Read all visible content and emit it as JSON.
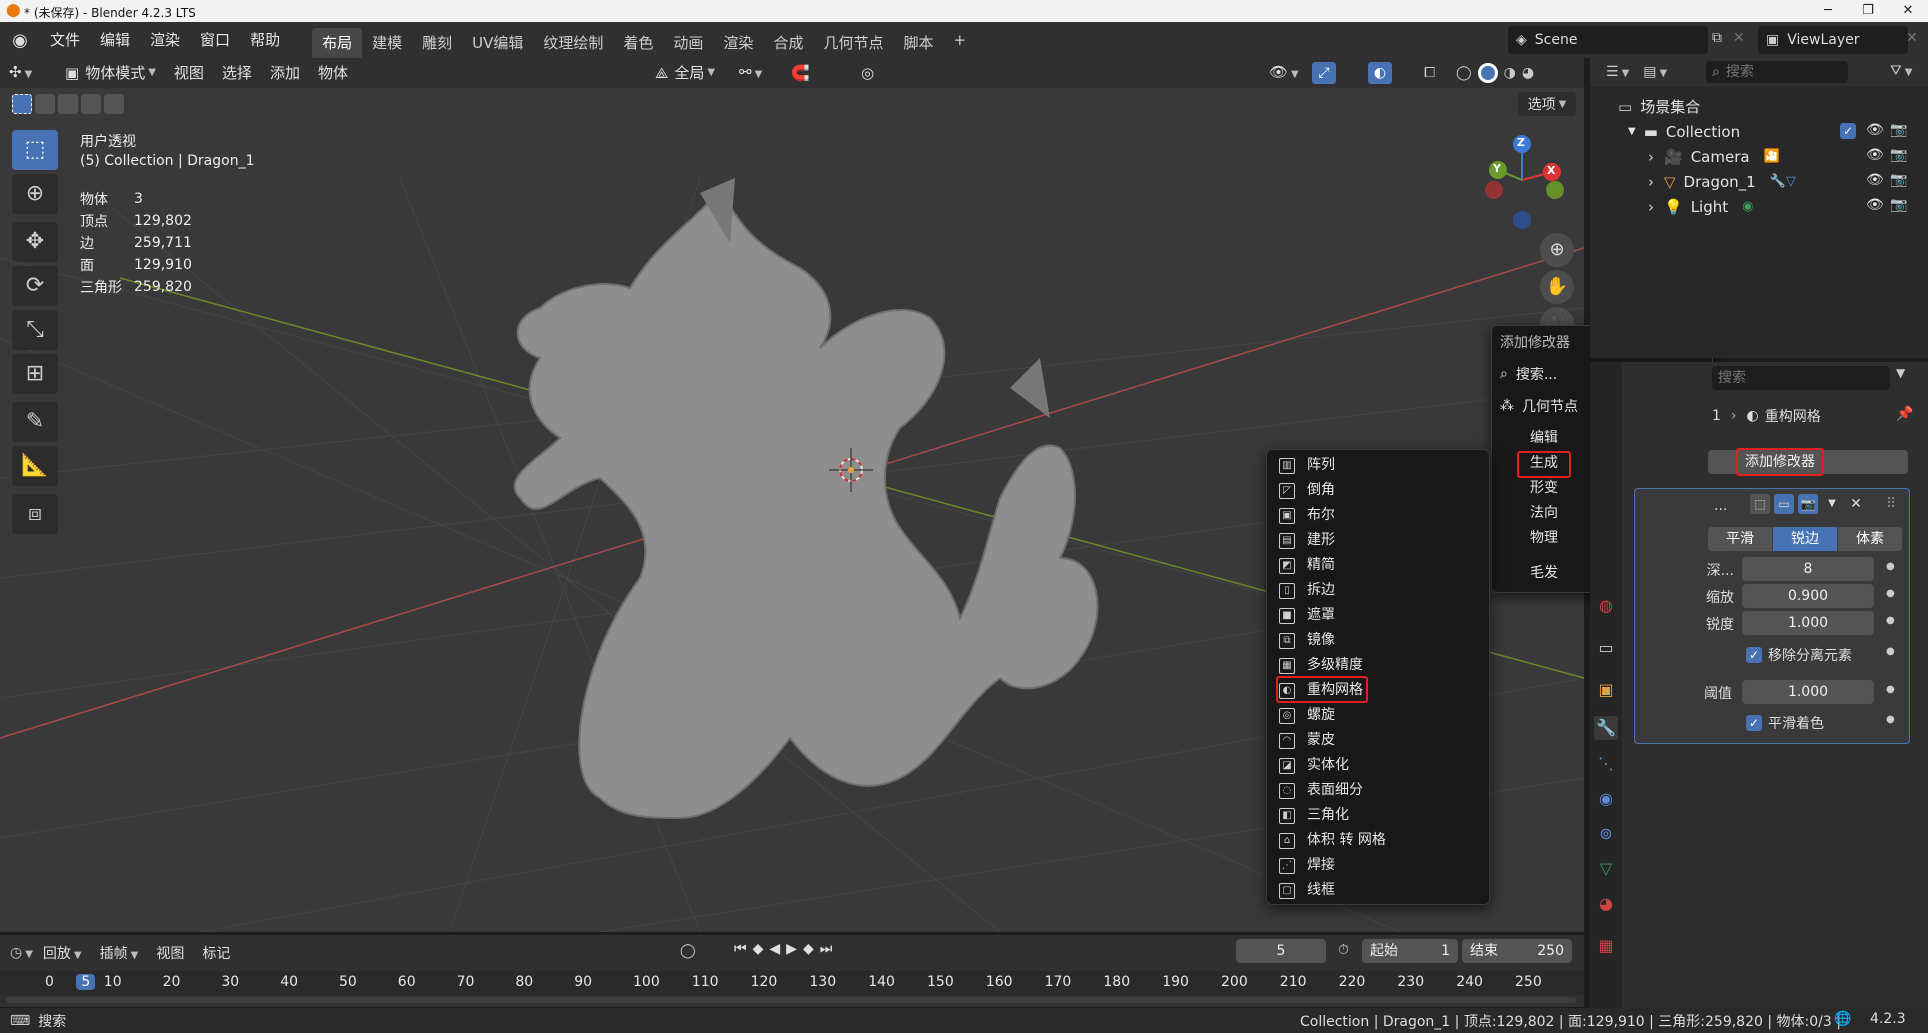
{
  "window": {
    "title": "* (未保存) - Blender 4.2.3 LTS",
    "minimize": "─",
    "maximize": "❐",
    "close": "✕"
  },
  "topbar": {
    "menus": [
      "文件",
      "编辑",
      "渲染",
      "窗口",
      "帮助"
    ],
    "tabs": [
      "布局",
      "建模",
      "雕刻",
      "UV编辑",
      "纹理绘制",
      "着色",
      "动画",
      "渲染",
      "合成",
      "几何节点",
      "脚本"
    ],
    "active_tab": "布局",
    "add_tab": "+",
    "scene": "Scene",
    "view_layer": "ViewLayer"
  },
  "viewport_header": {
    "mode": "物体模式",
    "menus": [
      "视图",
      "选择",
      "添加",
      "物体"
    ],
    "transform_orientation": "全局",
    "options": "选项"
  },
  "overlay": {
    "view_name": "用户透视",
    "collection_line": "(5) Collection | Dragon_1",
    "stats": [
      {
        "label": "物体",
        "value": "3"
      },
      {
        "label": "顶点",
        "value": "129,802"
      },
      {
        "label": "边",
        "value": "259,711"
      },
      {
        "label": "面",
        "value": "129,910"
      },
      {
        "label": "三角形",
        "value": "259,820"
      }
    ]
  },
  "gizmo": {
    "z": "Z",
    "y": "Y",
    "x": "X"
  },
  "outliner": {
    "search_placeholder": "搜索",
    "scene_collection": "场景集合",
    "collection": "Collection",
    "items": [
      {
        "name": "Camera"
      },
      {
        "name": "Dragon_1"
      },
      {
        "name": "Light"
      }
    ]
  },
  "properties": {
    "search_placeholder": "搜索",
    "breadcrumb_obj": "1",
    "breadcrumb_mod": "重构网格",
    "add_modifier": "添加修改器",
    "modifier_name": "...",
    "mode_tabs": [
      "平滑",
      "锐边",
      "体素"
    ],
    "active_mode": "锐边",
    "fields": [
      {
        "label": "深...",
        "value": "8"
      },
      {
        "label": "缩放",
        "value": "0.900"
      },
      {
        "label": "锐度",
        "value": "1.000"
      }
    ],
    "remove_disconnected": "移除分离元素",
    "threshold_label": "阈值",
    "threshold_value": "1.000",
    "smooth_shading": "平滑着色"
  },
  "add_modifier_menu": {
    "title": "添加修改器",
    "search": "搜索...",
    "geometry_nodes": "几何节点",
    "categories": [
      "编辑",
      "生成",
      "形变",
      "法向",
      "物理"
    ],
    "hair": "毛发",
    "highlighted": "生成"
  },
  "generate_submenu": {
    "items": [
      "阵列",
      "倒角",
      "布尔",
      "建形",
      "精简",
      "拆边",
      "遮罩",
      "镜像",
      "多级精度",
      "重构网格",
      "螺旋",
      "蒙皮",
      "实体化",
      "表面细分",
      "三角化",
      "体积 转 网格",
      "焊接",
      "线框"
    ],
    "highlighted": "重构网格"
  },
  "timeline": {
    "menus": [
      "回放",
      "插帧",
      "视图",
      "标记"
    ],
    "current_frame": "5",
    "start_label": "起始",
    "start": "1",
    "end_label": "结束",
    "end": "250",
    "ruler": [
      "0",
      "5",
      "10",
      "20",
      "30",
      "40",
      "50",
      "60",
      "70",
      "80",
      "90",
      "100",
      "110",
      "120",
      "130",
      "140",
      "150",
      "160",
      "170",
      "180",
      "190",
      "200",
      "210",
      "220",
      "230",
      "240",
      "250"
    ]
  },
  "statusbar": {
    "search": "搜索",
    "info": "Collection | Dragon_1 | 顶点:129,802 | 面:129,910 | 三角形:259,820 | 物体:0/3 |",
    "version": "4.2.3"
  },
  "colors": {
    "accent": "#4772b3",
    "highlight": "#e02020",
    "blender_orange": "#e87d0d"
  }
}
